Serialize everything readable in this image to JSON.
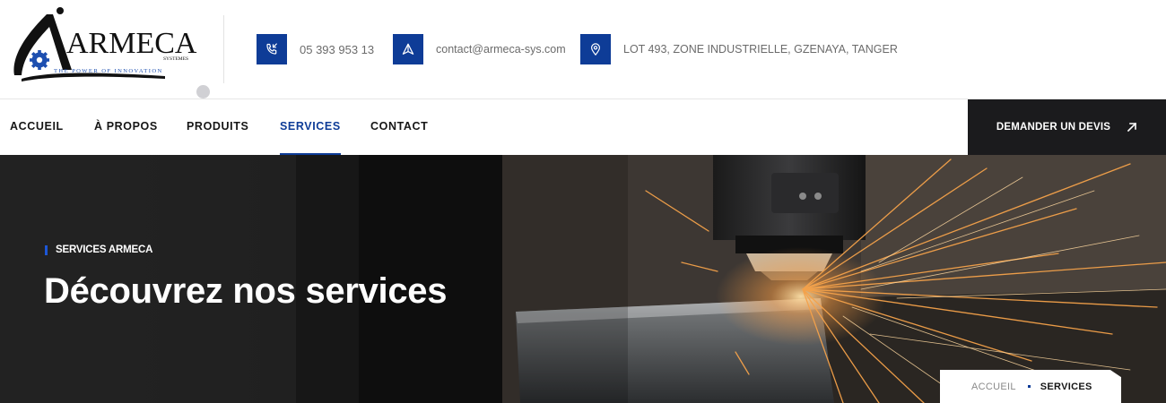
{
  "brand": {
    "name": "ARMECA",
    "sub": "SYSTEMES",
    "tagline": "THE POWER OF INNOVATION"
  },
  "contact": {
    "phone": "05 393 953 13",
    "email": "contact@armeca-sys.com",
    "address": "LOT 493, ZONE INDUSTRIELLE, GZENAYA, TANGER"
  },
  "nav": {
    "items": [
      {
        "label": "ACCUEIL"
      },
      {
        "label": "À PROPOS"
      },
      {
        "label": "PRODUITS"
      },
      {
        "label": "SERVICES"
      },
      {
        "label": "CONTACT"
      }
    ],
    "active_index": 3,
    "cta_label": "DEMANDER UN DEVIS"
  },
  "hero": {
    "eyebrow": "SERVICES ARMECA",
    "title": "Découvrez nos services"
  },
  "breadcrumb": {
    "home": "ACCUEIL",
    "current": "SERVICES"
  },
  "icons": {
    "phone": "phone-icon",
    "email": "send-icon",
    "address": "location-pin-icon",
    "cta": "arrow-up-right-icon"
  },
  "colors": {
    "brand_blue": "#0e3c97",
    "cta_bg": "#1b1b1d",
    "spark": "#f5a24a"
  }
}
